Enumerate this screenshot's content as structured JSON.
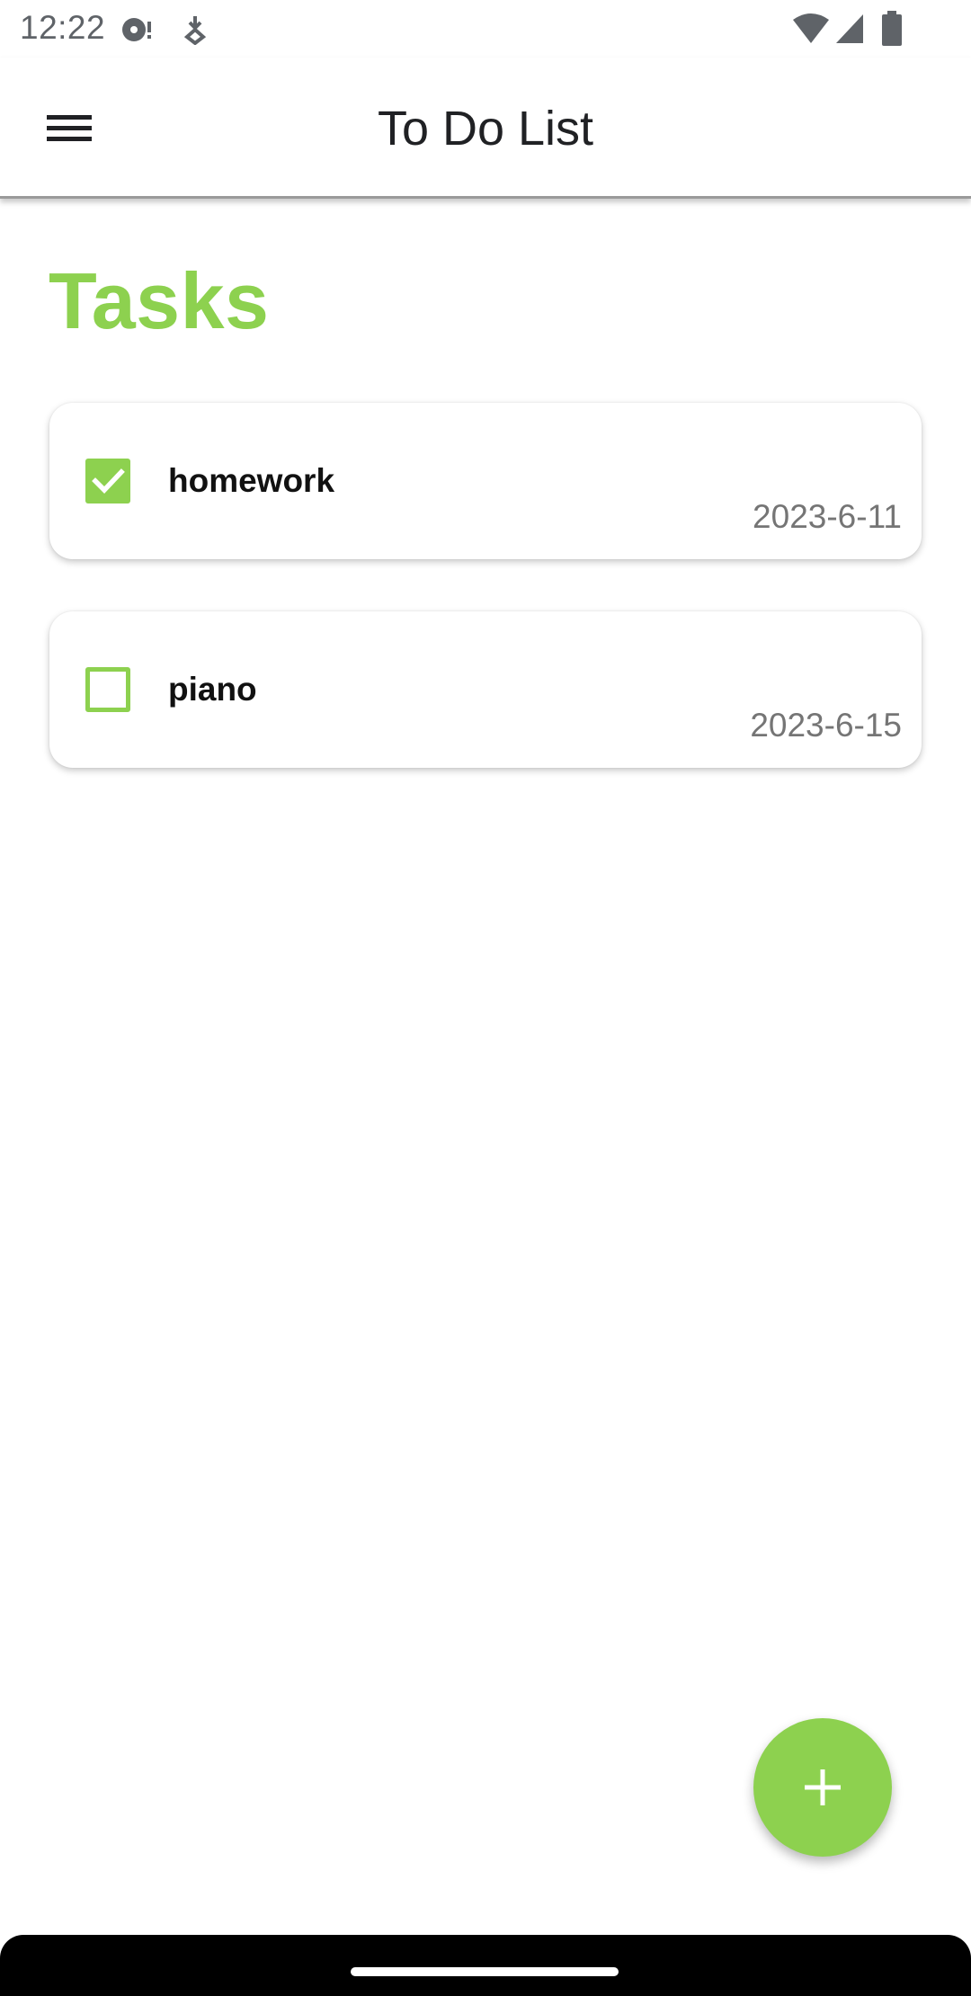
{
  "status_bar": {
    "time": "12:22",
    "icons": [
      "media-notification-icon",
      "download-notification-icon",
      "wifi-icon",
      "cell-signal-icon",
      "battery-icon"
    ]
  },
  "app_bar": {
    "title": "To Do List",
    "menu_icon": "hamburger-menu-icon"
  },
  "page": {
    "heading": "Tasks"
  },
  "tasks": [
    {
      "name": "homework",
      "date": "2023-6-11",
      "completed": true
    },
    {
      "name": "piano",
      "date": "2023-6-15",
      "completed": false
    }
  ],
  "fab": {
    "icon": "plus-icon"
  },
  "colors": {
    "accent": "#8dd14f",
    "title_text": "#202124",
    "date_text": "#757575",
    "nav_bar": "#000000"
  }
}
